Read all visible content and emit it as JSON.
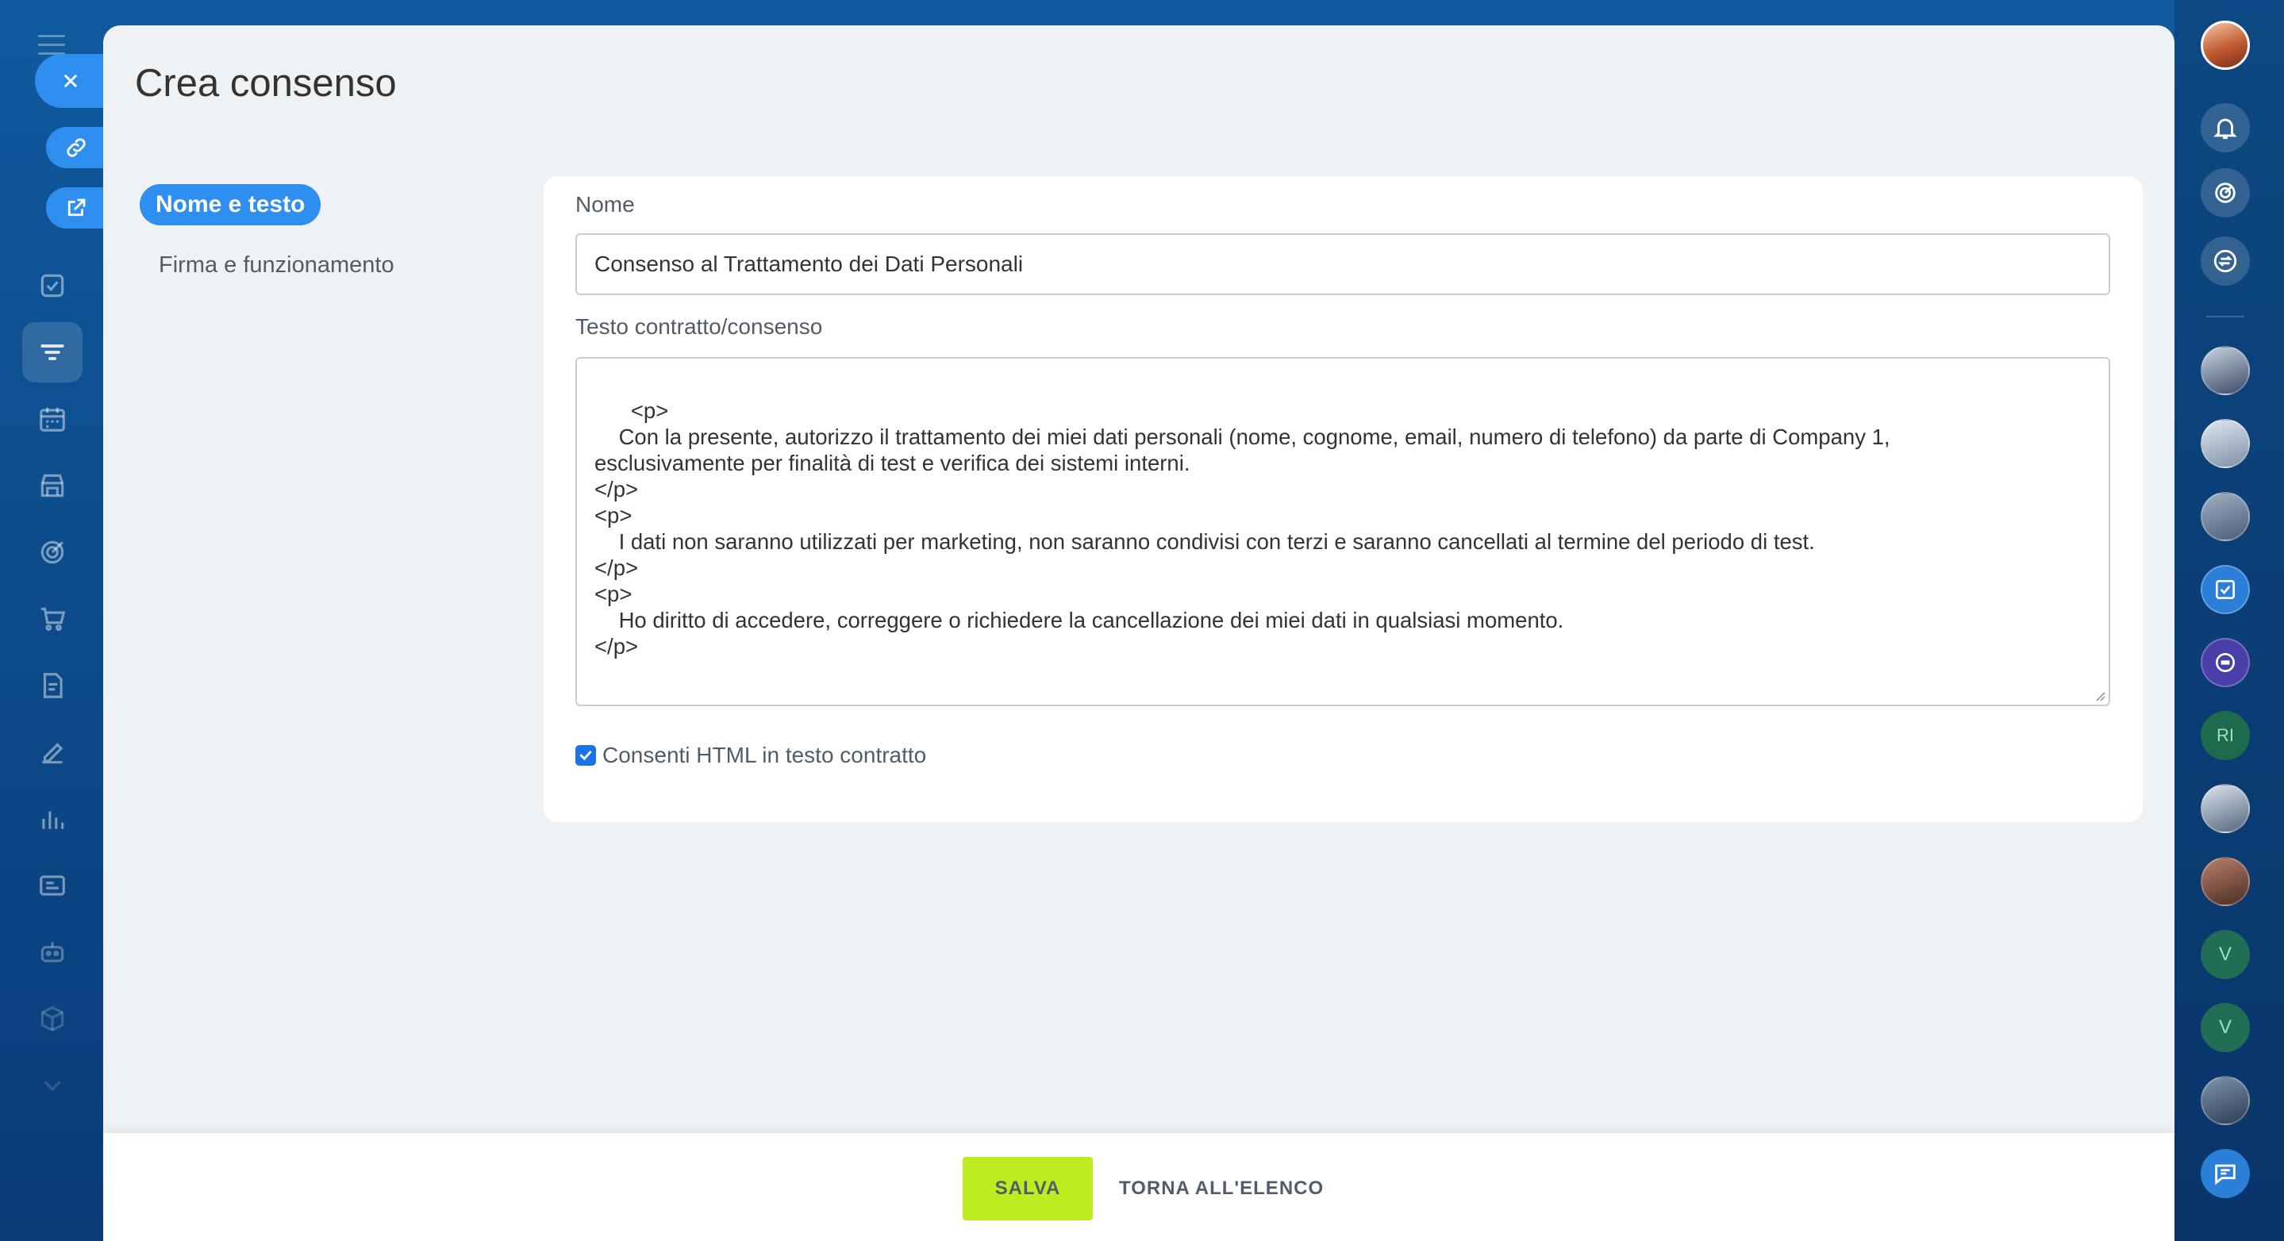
{
  "panel": {
    "title": "Crea consenso"
  },
  "nav": {
    "items": [
      {
        "label": "Nome e testo",
        "active": true
      },
      {
        "label": "Firma e funzionamento",
        "active": false
      }
    ]
  },
  "form": {
    "name_label": "Nome",
    "name_value": "Consenso al Trattamento dei Dati Personali",
    "text_label": "Testo contratto/consenso",
    "text_value": "<p>\n    Con la presente, autorizzo il trattamento dei miei dati personali (nome, cognome, email, numero di telefono) da parte di Company 1,\nesclusivamente per finalità di test e verifica dei sistemi interni.\n</p>\n<p>\n    I dati non saranno utilizzati per marketing, non saranno condivisi con terzi e saranno cancellati al termine del periodo di test.\n</p>\n<p>\n    Ho diritto di accedere, correggere o richiedere la cancellazione dei miei dati in qualsiasi momento.\n</p>",
    "allow_html_label": "Consenti HTML in testo contratto",
    "allow_html_checked": true
  },
  "footer": {
    "save_label": "SALVA",
    "back_label": "TORNA ALL'ELENCO"
  },
  "rightbar": {
    "initials": [
      "RI",
      "V",
      "V"
    ]
  },
  "colors": {
    "accent": "#2f8ff0",
    "save_button": "#bbed21",
    "panel_bg": "#eef2f4",
    "page_bg": "#0d4c8c"
  },
  "icons": {
    "left_nav": [
      "home-icon",
      "crm-icon",
      "tasks-icon",
      "filter-icon",
      "calendar-icon",
      "store-icon",
      "target-icon",
      "cart-icon",
      "document-icon",
      "signature-icon",
      "chart-icon",
      "contact-card-icon",
      "robot-icon",
      "box-icon",
      "chevron-down-icon"
    ],
    "right_bar": [
      "bell-icon",
      "target-icon",
      "sync-icon"
    ]
  }
}
